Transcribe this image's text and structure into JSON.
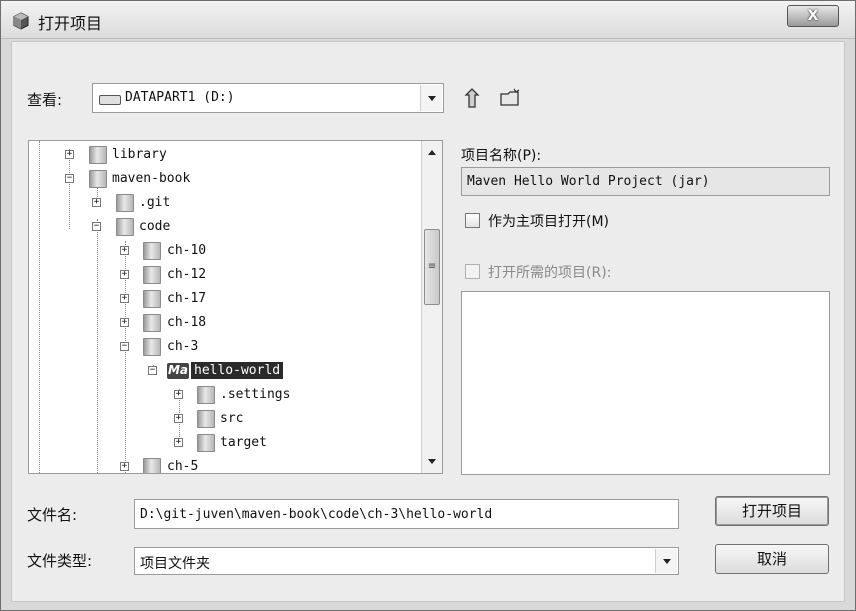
{
  "window": {
    "title": "打开项目",
    "close_label": "X"
  },
  "look_in": {
    "label": "查看:",
    "value": "DATAPART1  (D:)"
  },
  "toolbar": {
    "icons": [
      "up-folder-icon",
      "new-folder-icon"
    ]
  },
  "tree": {
    "items": [
      {
        "label": "library",
        "expander": "+",
        "icon": "folder"
      },
      {
        "label": "maven-book",
        "expander": "−",
        "icon": "folder"
      },
      {
        "label": ".git",
        "expander": "+",
        "icon": "folder"
      },
      {
        "label": "code",
        "expander": "−",
        "icon": "folder"
      },
      {
        "label": "ch-10",
        "expander": "+",
        "icon": "folder"
      },
      {
        "label": "ch-12",
        "expander": "+",
        "icon": "folder"
      },
      {
        "label": "ch-17",
        "expander": "+",
        "icon": "folder"
      },
      {
        "label": "ch-18",
        "expander": "+",
        "icon": "folder"
      },
      {
        "label": "ch-3",
        "expander": "−",
        "icon": "folder"
      },
      {
        "label": "hello-world",
        "expander": "−",
        "icon": "maven-project",
        "selected": true
      },
      {
        "label": ".settings",
        "expander": "+",
        "icon": "folder"
      },
      {
        "label": "src",
        "expander": "+",
        "icon": "folder"
      },
      {
        "label": "target",
        "expander": "+",
        "icon": "folder"
      },
      {
        "label": "ch-5",
        "expander": "+",
        "icon": "folder"
      }
    ]
  },
  "project": {
    "name_label": "项目名称(P):",
    "name_value": "Maven Hello World Project (jar)",
    "main_project_label": "作为主项目打开(M)",
    "required_projects_label": "打开所需的项目(R):"
  },
  "file": {
    "name_label": "文件名:",
    "name_value": "D:\\git-juven\\maven-book\\code\\ch-3\\hello-world",
    "type_label": "文件类型:",
    "type_value": "项目文件夹"
  },
  "buttons": {
    "open_label": "打开项目",
    "cancel_label": "取消"
  }
}
